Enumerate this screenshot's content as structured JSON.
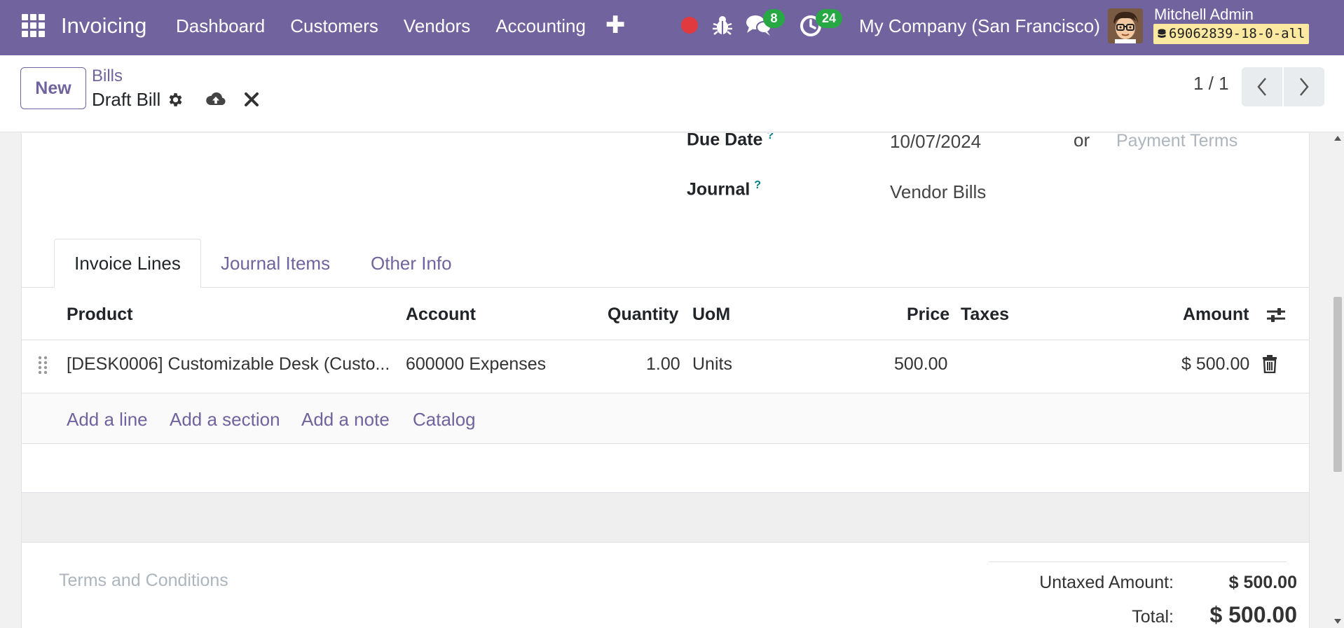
{
  "navbar": {
    "app_name": "Invoicing",
    "menu": [
      "Dashboard",
      "Customers",
      "Vendors",
      "Accounting"
    ],
    "add_icon": "plus-icon",
    "chat_badge": "8",
    "activity_badge": "24",
    "company": "My Company (San Francisco)",
    "user_name": "Mitchell Admin",
    "db_name": "69062839-18-0-all",
    "colors": {
      "bar": "#71639e",
      "badge": "#28a745",
      "record": "#e03a3e"
    }
  },
  "control_panel": {
    "new_label": "New",
    "breadcrumb_parent": "Bills",
    "breadcrumb_current": "Draft Bill",
    "pager": "1 / 1"
  },
  "form": {
    "due_date_label": "Due Date",
    "due_date_value": "10/07/2024",
    "or_text": "or",
    "payment_terms_placeholder": "Payment Terms",
    "journal_label": "Journal",
    "journal_value": "Vendor Bills",
    "help_mark": "?"
  },
  "tabs": [
    "Invoice Lines",
    "Journal Items",
    "Other Info"
  ],
  "lines_table": {
    "headers": {
      "product": "Product",
      "account": "Account",
      "quantity": "Quantity",
      "uom": "UoM",
      "price": "Price",
      "taxes": "Taxes",
      "amount": "Amount"
    },
    "rows": [
      {
        "product": "[DESK0006] Customizable Desk (Custo...",
        "account": "600000 Expenses",
        "quantity": "1.00",
        "uom": "Units",
        "price": "500.00",
        "taxes": "",
        "amount": "$ 500.00"
      }
    ],
    "add_links": [
      "Add a line",
      "Add a section",
      "Add a note",
      "Catalog"
    ]
  },
  "footer": {
    "terms_placeholder": "Terms and Conditions",
    "untaxed_label": "Untaxed Amount:",
    "untaxed_value": "$ 500.00",
    "total_label": "Total:",
    "total_value": "$ 500.00"
  }
}
